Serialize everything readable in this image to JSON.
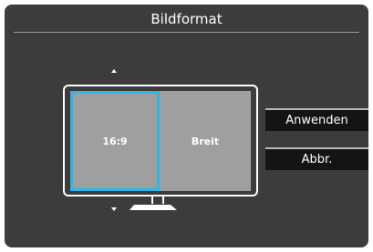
{
  "osd": {
    "title": "Bildformat"
  },
  "aspect_options": [
    {
      "label": "16:9",
      "selected": true
    },
    {
      "label": "Breit",
      "selected": false
    }
  ],
  "buttons": {
    "apply_label": "Anwenden",
    "cancel_label": "Abbr."
  },
  "colors": {
    "panel_background": "#3d3b3b",
    "screen_gray": "#a09f9f",
    "selection_accent": "#2bb8e8",
    "button_background": "#141414"
  },
  "icons": {
    "scroll_up": "arrow-up-icon",
    "scroll_down": "arrow-down-icon",
    "monitor": "monitor-icon"
  }
}
